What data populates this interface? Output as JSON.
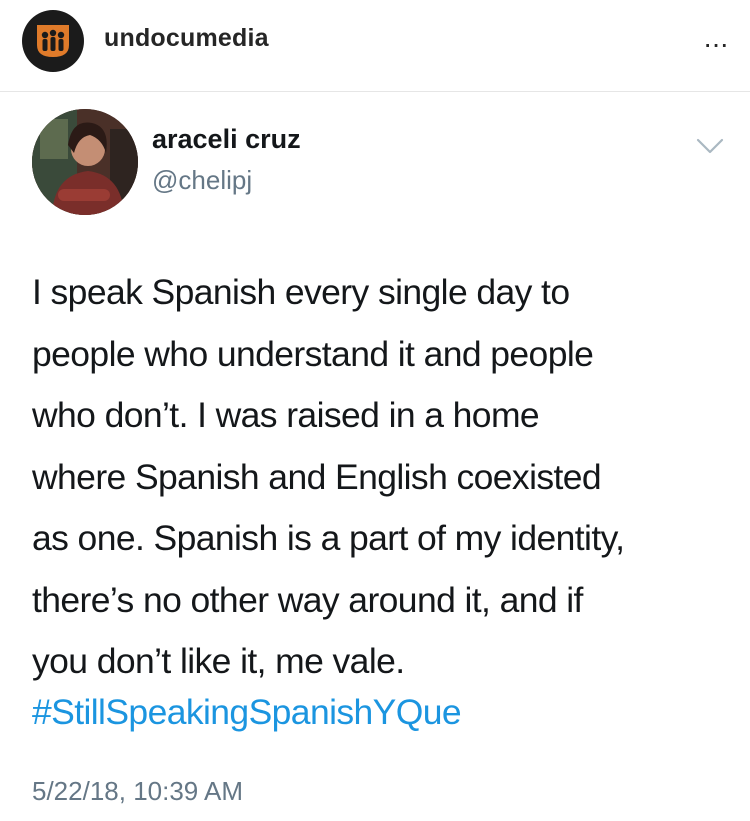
{
  "account": {
    "username": "undocumedia",
    "more_label": "···",
    "avatar_icon": "undocumedia-logo-icon"
  },
  "tweet": {
    "author_name": "araceli cruz",
    "author_handle": "@chelipj",
    "text": "I speak Spanish every single day to\npeople who understand it and people\nwho don’t. I was raised in a home\nwhere Spanish and English coexisted\nas one. Spanish is a part of my identity,\nthere’s no other way around it, and if\nyou don’t like it, me vale.",
    "hashtag": "#StillSpeakingSpanishYQue",
    "timestamp": "5/22/18, 10:39 AM",
    "menu_icon": "chevron-down-icon"
  },
  "colors": {
    "link": "#1b95e0",
    "secondary_text": "#657786",
    "primary_text": "#14171a"
  }
}
